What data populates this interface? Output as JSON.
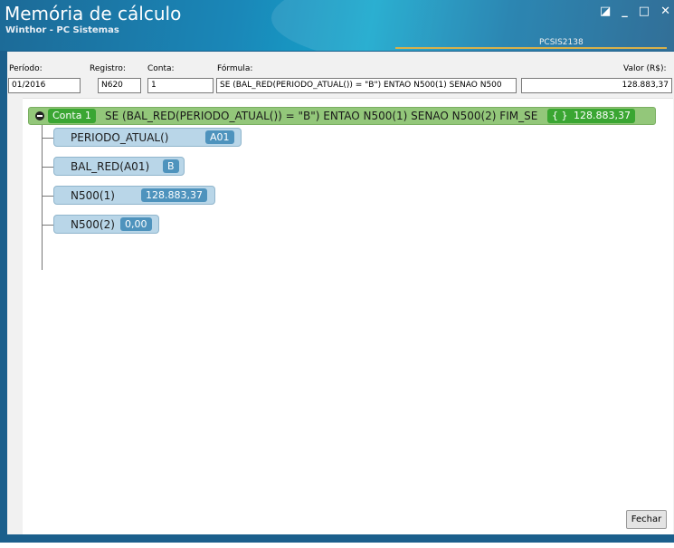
{
  "window": {
    "title": "Memória de cálculo",
    "subtitle": "Winthor - PC Sistemas",
    "screen_code": "PCSIS2138",
    "controls": {
      "restore": "◪",
      "minimize": "_",
      "maximize": "□",
      "close": "✕"
    }
  },
  "form": {
    "periodo_label": "Período:",
    "periodo_value": "01/2016",
    "registro_label": "Registro:",
    "registro_value": "N620",
    "conta_label": "Conta:",
    "conta_value": "1",
    "formula_label": "Fórmula:",
    "formula_value": "SE (BAL_RED(PERIODO_ATUAL()) = \"B\") ENTAO N500(1) SENAO N500",
    "valor_label": "Valor (R$):",
    "valor_value": "128.883,37"
  },
  "tree": {
    "root": {
      "badge": "Conta 1",
      "expression": "SE (BAL_RED(PERIODO_ATUAL()) = \"B\") ENTAO N500(1) SENAO N500(2) FIM_SE",
      "bracket_badge": "{ }",
      "value": "128.883,37"
    },
    "children": [
      {
        "name": "PERIODO_ATUAL()",
        "value": "A01"
      },
      {
        "name": "BAL_RED(A01)",
        "value": "B"
      },
      {
        "name": "N500(1)",
        "value": "128.883,37"
      },
      {
        "name": "N500(2)",
        "value": "0,00"
      }
    ]
  },
  "footer": {
    "close_label": "Fechar"
  },
  "colors": {
    "titlebar": "#1b5f8c",
    "root_node": "#93c77a",
    "child_node": "#b9d6e8",
    "value_badge": "#4e93bd",
    "green_badge": "#3aa632"
  }
}
